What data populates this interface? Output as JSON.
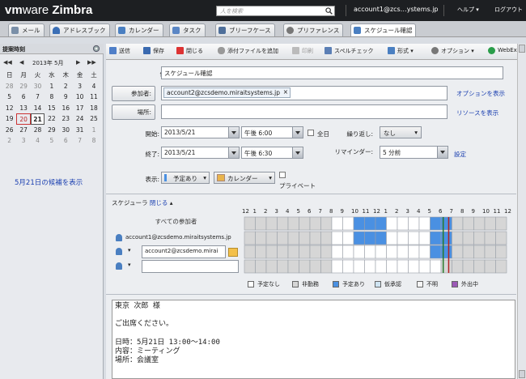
{
  "header": {
    "logo_vm": "vm",
    "logo_ware": "ware",
    "logo_product": " Zimbra",
    "search_placeholder": "人を検索",
    "account": "account1@zcs…ystems.jp",
    "help": "ヘルプ",
    "logout": "ログアウト"
  },
  "app_tabs": [
    {
      "label": "メール",
      "icon": "mail-icon",
      "color": "#7a8fa8"
    },
    {
      "label": "アドレスブック",
      "icon": "addressbook-icon",
      "color": "#3b6fb6"
    },
    {
      "label": "カレンダー",
      "icon": "calendar-icon",
      "color": "#4a7fc1"
    },
    {
      "label": "タスク",
      "icon": "task-icon",
      "color": "#5a86c5"
    },
    {
      "label": "ブリーフケース",
      "icon": "briefcase-icon",
      "color": "#4f6f9a"
    },
    {
      "label": "プリファレンス",
      "icon": "gear-icon",
      "color": "#777"
    },
    {
      "label": "スケジュール確認",
      "icon": "appointment-icon",
      "color": "#4a7fc1"
    }
  ],
  "left_pane": {
    "title": "提案時刻",
    "calendar": {
      "month": "2013年 5月",
      "weekdays": [
        "日",
        "月",
        "火",
        "水",
        "木",
        "金",
        "土"
      ],
      "weeks": [
        [
          "28",
          "29",
          "30",
          "1",
          "2",
          "3",
          "4"
        ],
        [
          "5",
          "6",
          "7",
          "8",
          "9",
          "10",
          "11"
        ],
        [
          "12",
          "13",
          "14",
          "15",
          "16",
          "17",
          "18"
        ],
        [
          "19",
          "20",
          "21",
          "22",
          "23",
          "24",
          "25"
        ],
        [
          "26",
          "27",
          "28",
          "29",
          "30",
          "31",
          "1"
        ],
        [
          "2",
          "3",
          "4",
          "5",
          "6",
          "7",
          "8"
        ]
      ]
    },
    "candidate_link": "5月21日の候補を表示"
  },
  "toolbar": {
    "send": "送信",
    "save": "保存",
    "close": "閉じる",
    "attach": "添付ファイルを追加",
    "print": "印刷",
    "spell": "スペルチェック",
    "format": "形式",
    "options": "オプション",
    "webex": "WebEx"
  },
  "form": {
    "subject_label": "件名:",
    "subject_value": "スケジュール確認",
    "attendees_button": "参加者:",
    "attendee_chip": "account2@zcsdemo.miraitsystems.jp",
    "show_options": "オプションを表示",
    "location_button": "場所:",
    "show_resources": "リソースを表示",
    "start_label": "開始:",
    "start_date": "2013/5/21",
    "start_time": "午後 6:00",
    "allday_label": "全日",
    "repeat_label": "繰り返し:",
    "repeat_value": "なし",
    "end_label": "終了:",
    "end_date": "2013/5/21",
    "end_time": "午後 6:30",
    "reminder_label": "リマインダー:",
    "reminder_value": "5 分前",
    "reminder_setting": "設定",
    "display_label": "表示:",
    "display_status": "予定あり",
    "display_calendar": "カレンダー",
    "private_label": "プライベート"
  },
  "scheduler": {
    "title": "スケジューラ",
    "toggle": "閉じる",
    "hours": [
      "12",
      "1",
      "2",
      "3",
      "4",
      "5",
      "6",
      "7",
      "8",
      "9",
      "10",
      "11",
      "12",
      "1",
      "2",
      "3",
      "4",
      "5",
      "6",
      "7",
      "8",
      "9",
      "10",
      "11",
      "12"
    ],
    "all_attendees": "すべての参加者",
    "row1": "account1@zcsdemo.miraitsystems.jp",
    "row2_value": "account2@zcsdemo.mirai",
    "legend": [
      "予定なし",
      "非勤務",
      "予定あり",
      "仮承認",
      "不明",
      "外出中"
    ],
    "legend_colors": [
      "#ffffff",
      "#d6d6d6",
      "#4a90e2",
      "#cfe4f2",
      "#f5f5f5",
      "#9b59b6"
    ]
  },
  "body_text": "東京 次郎 様\n\nご出席ください。\n\n日時：5月21日 13:00～14:00\n内容：ミーティング\n場所：会議室"
}
